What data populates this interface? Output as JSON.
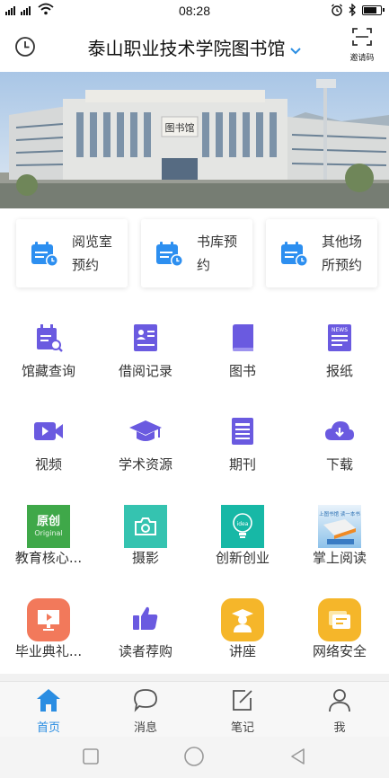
{
  "status_bar": {
    "time": "08:28"
  },
  "header": {
    "title": "泰山职业技术学院图书馆",
    "invite_label": "邀请码"
  },
  "banner": {
    "sign_text": "图书馆"
  },
  "booking": [
    {
      "label": "阅览室预约"
    },
    {
      "label": "书库预约"
    },
    {
      "label": "其他场所预约"
    }
  ],
  "grid": [
    {
      "label": "馆藏查询",
      "icon": "catalog-search-icon"
    },
    {
      "label": "借阅记录",
      "icon": "borrow-record-icon"
    },
    {
      "label": "图书",
      "icon": "book-icon"
    },
    {
      "label": "报纸",
      "icon": "newspaper-icon"
    },
    {
      "label": "视频",
      "icon": "video-icon"
    },
    {
      "label": "学术资源",
      "icon": "graduation-cap-icon"
    },
    {
      "label": "期刊",
      "icon": "journal-icon"
    },
    {
      "label": "下载",
      "icon": "cloud-download-icon"
    },
    {
      "label": "教育核心...",
      "icon": "original-logo-icon",
      "icon_text": "原创",
      "icon_subtext": "Original"
    },
    {
      "label": "摄影",
      "icon": "camera-icon"
    },
    {
      "label": "创新创业",
      "icon": "lightbulb-idea-icon",
      "icon_text": "idea"
    },
    {
      "label": "掌上阅读",
      "icon": "mobile-reading-icon",
      "icon_text": "上图书馆  读一本书"
    },
    {
      "label": "毕业典礼...",
      "icon": "presentation-icon"
    },
    {
      "label": "读者荐购",
      "icon": "thumbs-up-icon"
    },
    {
      "label": "讲座",
      "icon": "lecturer-icon"
    },
    {
      "label": "网络安全",
      "icon": "network-security-icon"
    }
  ],
  "tabs": [
    {
      "label": "首页",
      "icon": "home-icon",
      "active": true
    },
    {
      "label": "消息",
      "icon": "message-icon"
    },
    {
      "label": "笔记",
      "icon": "note-icon"
    },
    {
      "label": "我",
      "icon": "profile-icon"
    }
  ],
  "colors": {
    "accent": "#2a8de2",
    "icon_purple": "#6a5ae0",
    "icon_blue": "#2d8ff0"
  }
}
